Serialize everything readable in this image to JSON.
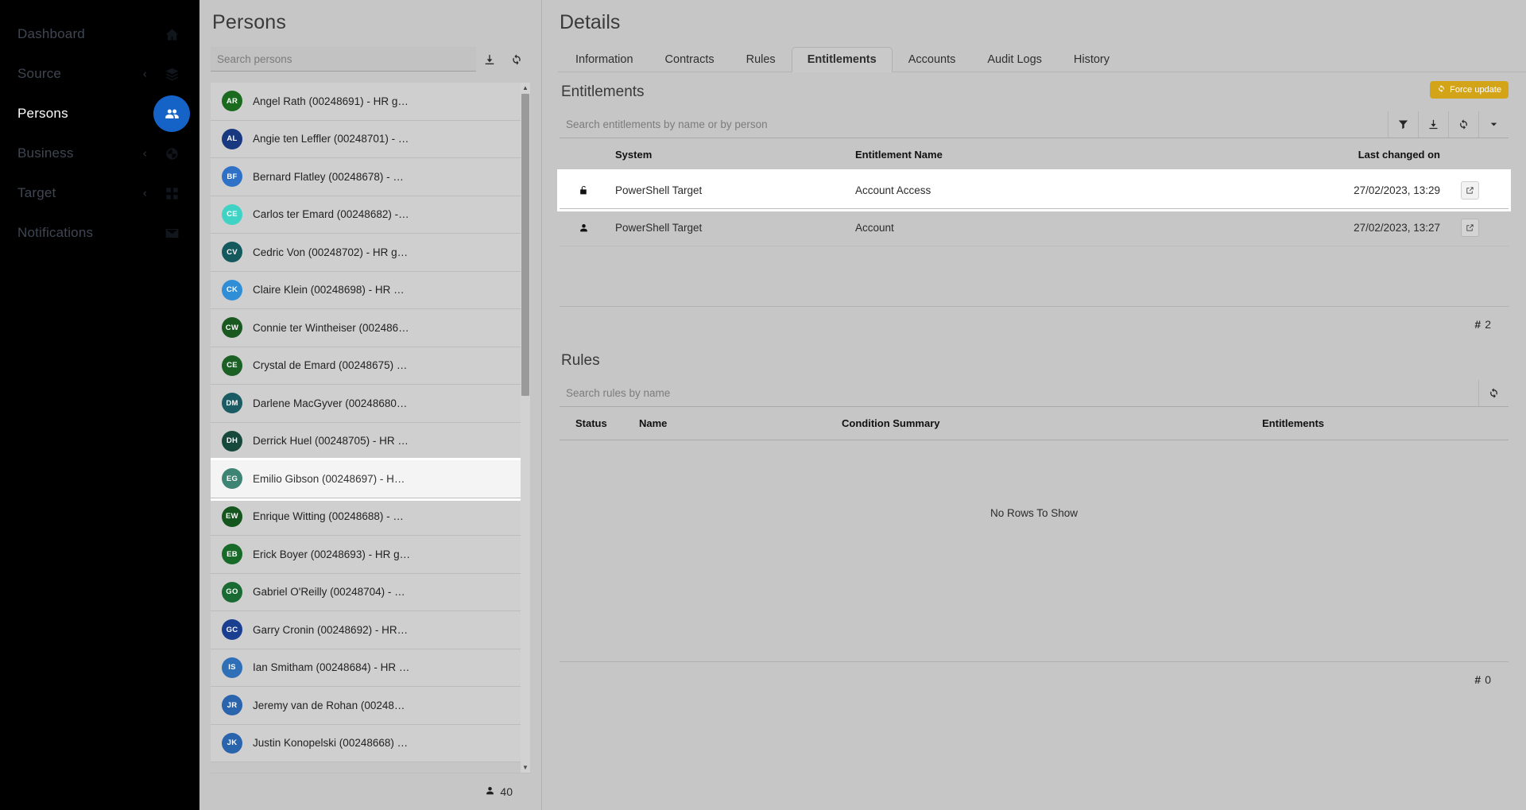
{
  "sidebar": {
    "items": [
      {
        "label": "Dashboard",
        "icon": "home-icon",
        "active": false,
        "chevron": false
      },
      {
        "label": "Source",
        "icon": "layers-icon",
        "active": false,
        "chevron": true
      },
      {
        "label": "Persons",
        "icon": "people-icon",
        "active": true,
        "chevron": false
      },
      {
        "label": "Business",
        "icon": "briefcase-icon",
        "active": false,
        "chevron": true
      },
      {
        "label": "Target",
        "icon": "grid-icon",
        "active": false,
        "chevron": true
      },
      {
        "label": "Notifications",
        "icon": "envelope-icon",
        "active": false,
        "chevron": false
      }
    ],
    "chevron_glyph": "‹",
    "accent_color": "#1663c7"
  },
  "persons": {
    "title": "Persons",
    "search_placeholder": "Search persons",
    "search_value": "",
    "download_icon": "download-icon",
    "refresh_icon": "refresh-icon",
    "count_label": "40",
    "count_icon": "person-icon",
    "rows": [
      {
        "initials": "AR",
        "name": "Angel Rath (00248691) - HR g…",
        "color": "#1b6b1f",
        "selected": false
      },
      {
        "initials": "AL",
        "name": "Angie ten Leffler (00248701) - …",
        "color": "#18387f",
        "selected": false
      },
      {
        "initials": "BF",
        "name": "Bernard Flatley (00248678) - …",
        "color": "#2f71c7",
        "selected": false
      },
      {
        "initials": "CE",
        "name": "Carlos ter Emard (00248682) -…",
        "color": "#3fd3c6",
        "selected": false
      },
      {
        "initials": "CV",
        "name": "Cedric Von (00248702) - HR g…",
        "color": "#13595e",
        "selected": false
      },
      {
        "initials": "CK",
        "name": "Claire Klein (00248698) - HR …",
        "color": "#2f8ed6",
        "selected": false
      },
      {
        "initials": "CW",
        "name": "Connie ter Wintheiser (002486…",
        "color": "#19591f",
        "selected": false
      },
      {
        "initials": "CE",
        "name": "Crystal de Emard (00248675) …",
        "color": "#1b6126",
        "selected": false
      },
      {
        "initials": "DM",
        "name": "Darlene MacGyver (00248680…",
        "color": "#1b5b63",
        "selected": false
      },
      {
        "initials": "DH",
        "name": "Derrick Huel (00248705) - HR …",
        "color": "#17483c",
        "selected": false
      },
      {
        "initials": "EG",
        "name": "Emilio Gibson (00248697) - H…",
        "color": "#3e8474",
        "selected": true
      },
      {
        "initials": "EW",
        "name": "Enrique Witting (00248688) - …",
        "color": "#14561d",
        "selected": false
      },
      {
        "initials": "EB",
        "name": "Erick Boyer (00248693) - HR g…",
        "color": "#186a28",
        "selected": false
      },
      {
        "initials": "GO",
        "name": "Gabriel O'Reilly (00248704) - …",
        "color": "#1a6b33",
        "selected": false
      },
      {
        "initials": "GC",
        "name": "Garry Cronin (00248692) - HR…",
        "color": "#1b3f90",
        "selected": false
      },
      {
        "initials": "IS",
        "name": "Ian Smitham (00248684) - HR …",
        "color": "#2e6fb8",
        "selected": false
      },
      {
        "initials": "JR",
        "name": "Jeremy van de Rohan (00248…",
        "color": "#2a64ad",
        "selected": false
      },
      {
        "initials": "JK",
        "name": "Justin Konopelski (00248668) …",
        "color": "#2a64ad",
        "selected": false
      }
    ]
  },
  "details": {
    "title": "Details",
    "tabs": [
      {
        "label": "Information",
        "active": false
      },
      {
        "label": "Contracts",
        "active": false
      },
      {
        "label": "Rules",
        "active": false
      },
      {
        "label": "Entitlements",
        "active": true
      },
      {
        "label": "Accounts",
        "active": false
      },
      {
        "label": "Audit Logs",
        "active": false
      },
      {
        "label": "History",
        "active": false
      }
    ],
    "entitlements": {
      "title": "Entitlements",
      "force_update_label": "Force update",
      "force_update_icon": "refresh-icon",
      "force_update_color": "#d3a318",
      "search_placeholder": "Search entitlements by name or by person",
      "search_value": "",
      "toolbar_icons": [
        "filter-icon",
        "download-icon",
        "refresh-icon",
        "chevron-down-icon"
      ],
      "columns": [
        "",
        "System",
        "Entitlement Name",
        "Last changed on",
        ""
      ],
      "rows": [
        {
          "icon": "unlock-icon",
          "system": "PowerShell Target",
          "entitlement_name": "Account Access",
          "last_changed_on": "27/02/2023, 13:29",
          "action_icon": "external-link-icon",
          "highlighted": true
        },
        {
          "icon": "person-icon",
          "system": "PowerShell Target",
          "entitlement_name": "Account",
          "last_changed_on": "27/02/2023, 13:27",
          "action_icon": "external-link-icon",
          "highlighted": false
        }
      ],
      "count_prefix": "#",
      "count": "2"
    },
    "rules": {
      "title": "Rules",
      "search_placeholder": "Search rules by name",
      "search_value": "",
      "refresh_icon": "refresh-icon",
      "columns": [
        "Status",
        "Name",
        "Condition Summary",
        "Entitlements"
      ],
      "empty_message": "No Rows To Show",
      "count_prefix": "#",
      "count": "0"
    }
  }
}
